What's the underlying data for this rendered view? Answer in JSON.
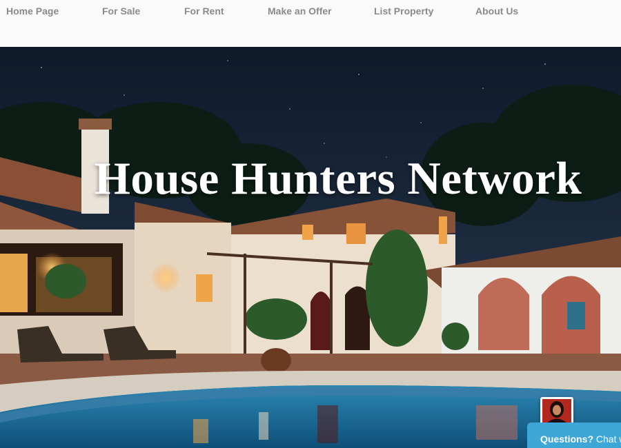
{
  "nav": {
    "items": [
      {
        "label": "Home Page"
      },
      {
        "label": "For Sale"
      },
      {
        "label": "For Rent"
      },
      {
        "label": "Make an Offer"
      },
      {
        "label": "List Property"
      },
      {
        "label": "About Us"
      }
    ]
  },
  "hero": {
    "title": "House Hunters Network",
    "image_description_icon": "villa-pool-night-photo"
  },
  "chat": {
    "question_label": "Questions?",
    "chat_label": " Chat w",
    "accent_color": "#3fa7d8"
  }
}
